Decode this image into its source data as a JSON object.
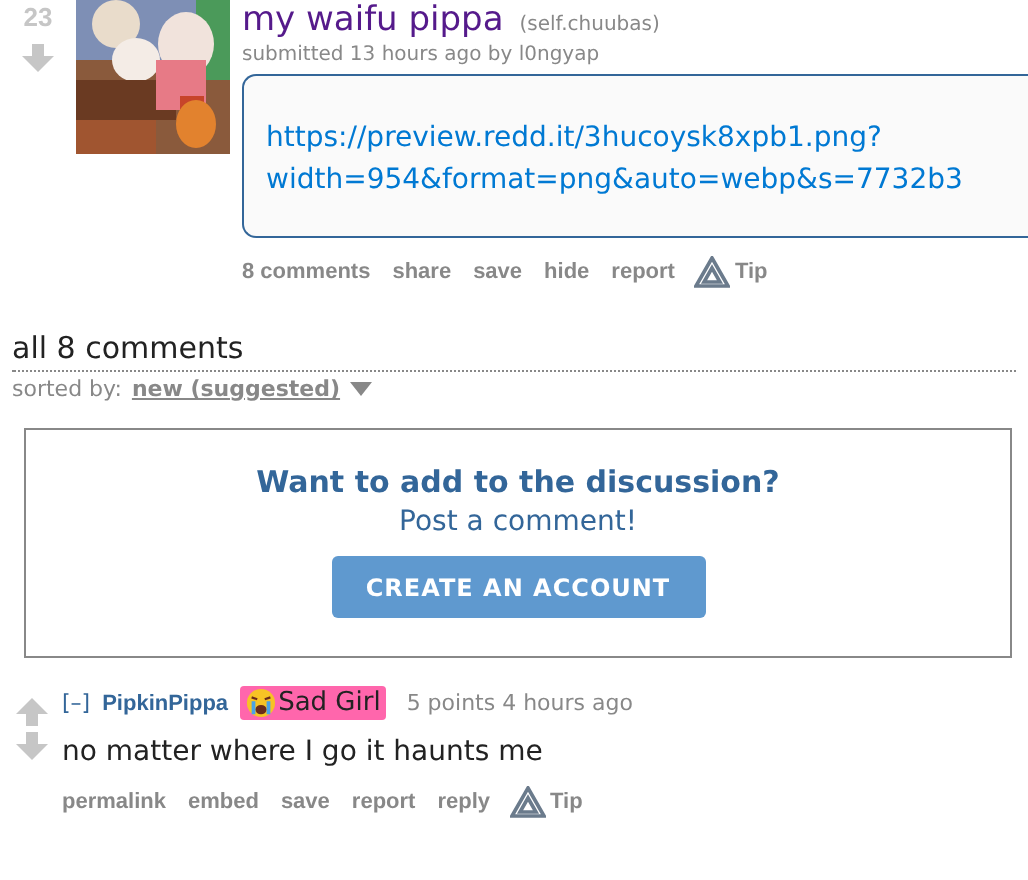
{
  "post": {
    "score": "23",
    "title": "my waifu pippa",
    "domain": "(self.chuubas)",
    "tagline": "submitted 13 hours ago by l0ngyap",
    "url_lines": [
      "https://preview.redd.it/3hucoysk8xpb1.png?",
      "width=954&format=png&auto=webp&s=7732b3"
    ],
    "buttons": [
      "8 comments",
      "share",
      "save",
      "hide",
      "report"
    ],
    "tip": "Tip"
  },
  "comments_header": {
    "title": "all 8 comments",
    "sort_label": "sorted by:",
    "sort_value": "new (suggested)"
  },
  "signup": {
    "heading": "Want to add to the discussion?",
    "subheading": "Post a comment!",
    "button": "CREATE AN ACCOUNT"
  },
  "comment": {
    "toggle": "[–]",
    "author": "PipkinPippa",
    "flair": "Sad Girl",
    "score_time": "5 points 4 hours ago",
    "body": "no matter where I go it haunts me",
    "buttons": [
      "permalink",
      "embed",
      "save",
      "report",
      "reply"
    ],
    "tip": "Tip"
  }
}
